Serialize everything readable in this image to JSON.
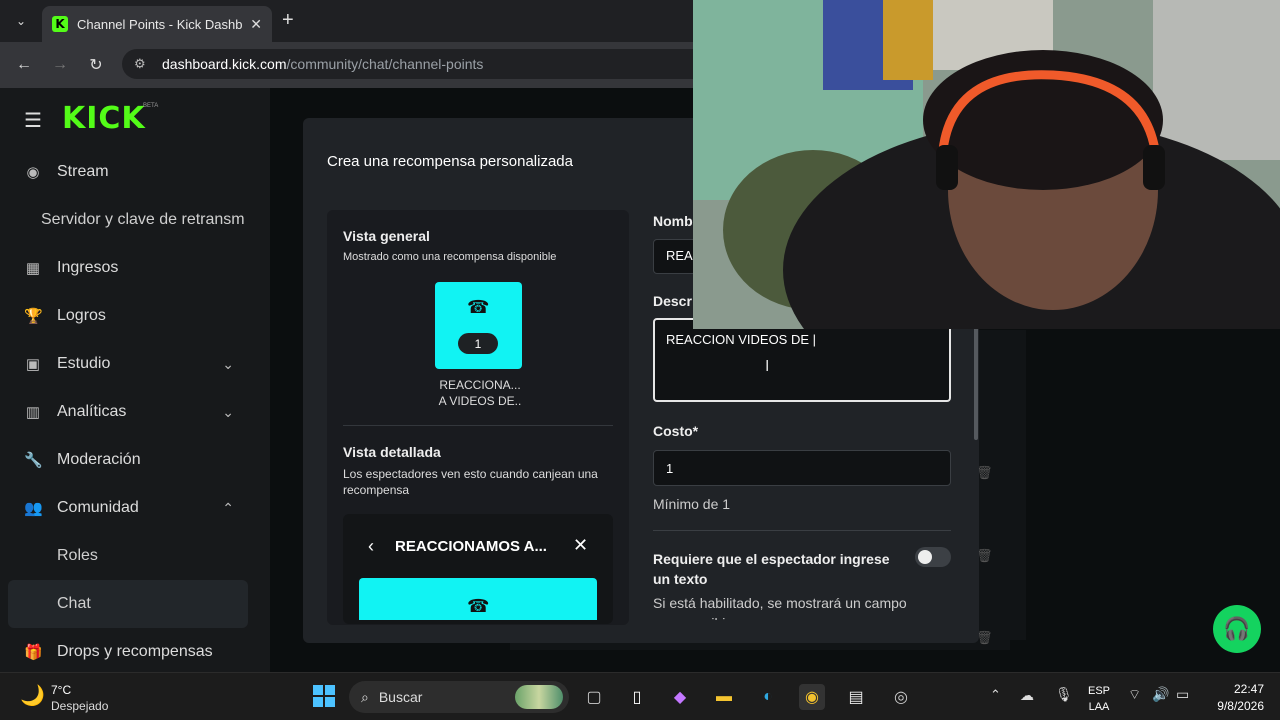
{
  "browser": {
    "tab_title": "Channel Points - Kick Dashboar",
    "favicon_letter": "K",
    "new_tab": "+",
    "url_host": "dashboard.kick.com",
    "url_path": "/community/chat/channel-points"
  },
  "sidebar": {
    "logo": "KICK",
    "logo_beta": "BETA",
    "items": {
      "stream": "Stream",
      "server_key": "Servidor y clave de retransm",
      "ingresos": "Ingresos",
      "logros": "Logros",
      "estudio": "Estudio",
      "analiticas": "Analíticas",
      "moderacion": "Moderación",
      "comunidad": "Comunidad",
      "roles": "Roles",
      "chat": "Chat",
      "drops": "Drops y recompensas"
    }
  },
  "modal": {
    "title": "Crea una recompensa personalizada",
    "overview": {
      "title": "Vista general",
      "subtitle": "Mostrado como una recompensa disponible",
      "cost": "1",
      "name_line1": "REACCIONA...",
      "name_line2": "A VIDEOS DE.."
    },
    "detail": {
      "title": "Vista detallada",
      "subtitle": "Los espectadores ven esto cuando canjean una recompensa",
      "reward_name": "REACCIONAMOS A..."
    },
    "form": {
      "name_label": "Nomb",
      "name_value": "REA",
      "desc_label": "Descr",
      "desc_value": "REACCION VIDEOS DE |",
      "cost_label": "Costo*",
      "cost_value": "1",
      "cost_hint": "Mínimo de 1",
      "require_label": "Requiere que el espectador ingrese un texto",
      "require_enabled": false,
      "require_hint": "Si está habilitado, se mostrará un campo para escribir"
    }
  },
  "taskbar": {
    "weather_temp": "7°C",
    "weather_cond": "Despejado",
    "search_placeholder": "Buscar",
    "lang_1": "ESP",
    "lang_2": "LAA",
    "time": "22:47",
    "date": "9/8/2026"
  },
  "colors": {
    "kick_green": "#53fc18",
    "reward_cyan": "#11f3f3",
    "support_green": "#14d35f"
  }
}
